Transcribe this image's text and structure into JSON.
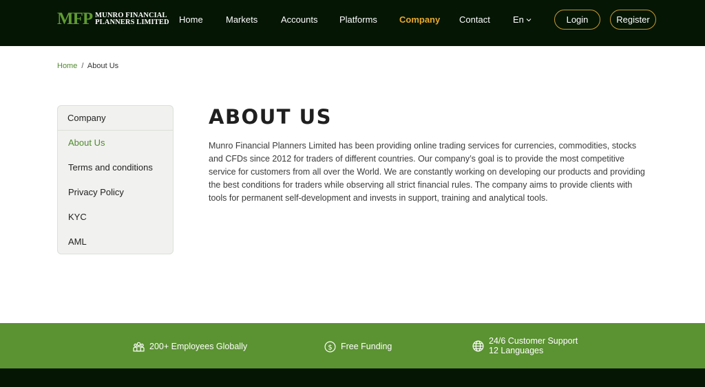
{
  "brand": {
    "mark": "MFP",
    "name_line1": "MUNRO FINANCIAL",
    "name_line2": "PLANNERS LIMITED",
    "accent_color": "#5f9a32",
    "header_bg": "#051605"
  },
  "nav": {
    "items": [
      {
        "label": "Home",
        "active": false
      },
      {
        "label": "Markets",
        "active": false
      },
      {
        "label": "Accounts",
        "active": false
      },
      {
        "label": "Platforms",
        "active": false
      },
      {
        "label": "Company",
        "active": true
      },
      {
        "label": "Contact",
        "active": false
      }
    ],
    "language": "En",
    "login_label": "Login",
    "register_label": "Register",
    "active_color": "#e8a92c"
  },
  "breadcrumb": {
    "home": "Home",
    "separator": "/",
    "current": "About Us"
  },
  "sidebar": {
    "heading": "Company",
    "items": [
      {
        "label": "About Us",
        "active": true
      },
      {
        "label": "Terms and conditions",
        "active": false
      },
      {
        "label": "Privacy Policy",
        "active": false
      },
      {
        "label": "KYC",
        "active": false
      },
      {
        "label": "AML",
        "active": false
      }
    ]
  },
  "main": {
    "title": "ABOUT US",
    "body": "Munro Financial Planners Limited has been providing online trading services for currencies, commodities, stocks and CFDs since 2012 for traders of different countries. Our company’s goal is to provide the most competitive service for customers from all over the World. We are constantly working on developing our products and providing the best conditions for traders while observing all strict financial rules. The company aims to provide clients with tools for permanent self-development and invests in support, training and analytical tools."
  },
  "features": {
    "band_color": "#5b9232",
    "employees": {
      "label": "200+ Employees Globally",
      "icon": "team-icon"
    },
    "funding": {
      "label": "Free Funding",
      "icon": "dollar-coin-icon"
    },
    "support": {
      "line1": "24/6 Customer Support",
      "line2": "12 Languages",
      "icon": "globe-icon"
    }
  }
}
